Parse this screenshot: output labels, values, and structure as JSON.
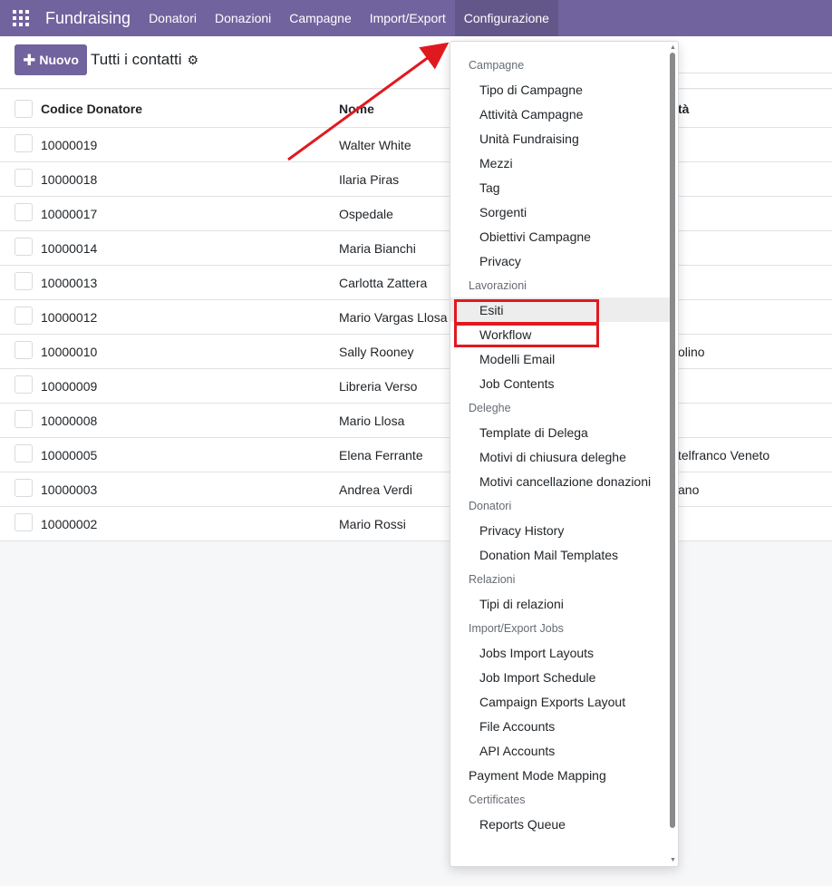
{
  "navbar": {
    "app_name": "Fundraising",
    "menus": [
      "Donatori",
      "Donazioni",
      "Campagne",
      "Import/Export",
      "Configurazione"
    ],
    "active_menu": "Configurazione"
  },
  "control_panel": {
    "new_button": "Nuovo",
    "breadcrumb": "Tutti i contatti"
  },
  "table": {
    "headers": {
      "code": "Codice Donatore",
      "name": "Nome",
      "city_partial": "tà"
    },
    "rows": [
      {
        "code": "10000019",
        "name": "Walter White",
        "city_partial": ""
      },
      {
        "code": "10000018",
        "name": "Ilaria Piras",
        "city_partial": ""
      },
      {
        "code": "10000017",
        "name": "Ospedale",
        "city_partial": ""
      },
      {
        "code": "10000014",
        "name": "Maria Bianchi",
        "city_partial": ""
      },
      {
        "code": "10000013",
        "name": "Carlotta Zattera",
        "city_partial": ""
      },
      {
        "code": "10000012",
        "name": "Mario Vargas Llosa",
        "city_partial": ""
      },
      {
        "code": "10000010",
        "name": "Sally Rooney",
        "city_partial": "olino"
      },
      {
        "code": "10000009",
        "name": "Libreria Verso",
        "city_partial": ""
      },
      {
        "code": "10000008",
        "name": "Mario Llosa",
        "city_partial": ""
      },
      {
        "code": "10000005",
        "name": "Elena Ferrante",
        "city_partial": "telfranco Veneto"
      },
      {
        "code": "10000003",
        "name": "Andrea Verdi",
        "city_partial": "ano"
      },
      {
        "code": "10000002",
        "name": "Mario Rossi",
        "city_partial": ""
      }
    ]
  },
  "config_menu": {
    "sections": [
      {
        "header": "Campagne",
        "items": [
          "Tipo di Campagne",
          "Attività Campagne",
          "Unità Fundraising",
          "Mezzi",
          "Tag",
          "Sorgenti",
          "Obiettivi Campagne",
          "Privacy"
        ]
      },
      {
        "header": "Lavorazioni",
        "items": [
          "Esiti",
          "Workflow",
          "Modelli Email",
          "Job Contents"
        ]
      },
      {
        "header": "Deleghe",
        "items": [
          "Template di Delega",
          "Motivi di chiusura deleghe",
          "Motivi cancellazione donazioni"
        ]
      },
      {
        "header": "Donatori",
        "items": [
          "Privacy History",
          "Donation Mail Templates"
        ]
      },
      {
        "header": "Relazioni",
        "items": [
          "Tipi di relazioni"
        ]
      },
      {
        "header": "Import/Export Jobs",
        "items": [
          "Jobs Import Layouts",
          "Job Import Schedule",
          "Campaign Exports Layout",
          "File Accounts",
          "API Accounts"
        ]
      },
      {
        "top_item": "Payment Mode Mapping"
      },
      {
        "header": "Certificates",
        "items": [
          "Reports Queue"
        ]
      }
    ],
    "hovered_item": "Esiti",
    "highlighted_items": [
      "Esiti",
      "Workflow"
    ]
  },
  "colors": {
    "brand": "#71639e",
    "annotation": "#e0191f"
  },
  "icons": {
    "apps": "apps-grid-icon",
    "new": "plus-icon",
    "settings": "gear-icon"
  }
}
